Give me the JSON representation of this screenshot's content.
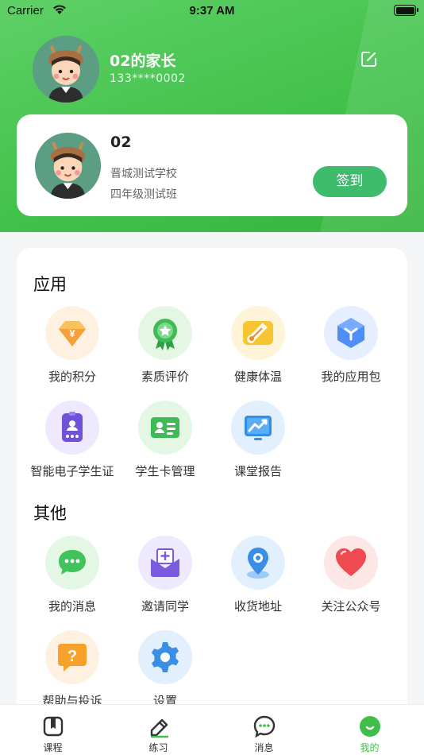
{
  "status_bar": {
    "carrier": "Carrier",
    "time": "9:37 AM"
  },
  "profile": {
    "parent_name": "02的家长",
    "phone": "133****0002",
    "avatar_icon": "cartoon-child-avatar",
    "edit_icon": "edit-icon"
  },
  "student": {
    "name": "02",
    "school": "晋城测试学校",
    "class": "四年级测试班",
    "checkin_label": "签到"
  },
  "apps": {
    "title": "应用",
    "items": [
      {
        "label": "我的积分",
        "icon": "points-icon"
      },
      {
        "label": "素质评价",
        "icon": "medal-icon"
      },
      {
        "label": "健康体温",
        "icon": "thermometer-icon"
      },
      {
        "label": "我的应用包",
        "icon": "app-package-icon"
      },
      {
        "label": "智能电子学生证",
        "icon": "student-id-icon"
      },
      {
        "label": "学生卡管理",
        "icon": "student-card-icon"
      },
      {
        "label": "课堂报告",
        "icon": "class-report-icon"
      }
    ]
  },
  "others": {
    "title": "其他",
    "items": [
      {
        "label": "我的消息",
        "icon": "message-icon"
      },
      {
        "label": "邀请同学",
        "icon": "invite-icon"
      },
      {
        "label": "收货地址",
        "icon": "location-icon"
      },
      {
        "label": "关注公众号",
        "icon": "heart-icon"
      },
      {
        "label": "帮助与投诉",
        "icon": "help-icon"
      },
      {
        "label": "设置",
        "icon": "settings-icon"
      }
    ]
  },
  "tabbar": {
    "items": [
      {
        "label": "课程",
        "icon": "course-icon"
      },
      {
        "label": "练习",
        "icon": "practice-icon"
      },
      {
        "label": "消息",
        "icon": "chat-icon"
      },
      {
        "label": "我的",
        "icon": "profile-icon",
        "active": true
      }
    ]
  },
  "colors": {
    "accent": "#43c24c",
    "checkin": "#3fbb6c",
    "active_tab": "#3fbf4a"
  }
}
